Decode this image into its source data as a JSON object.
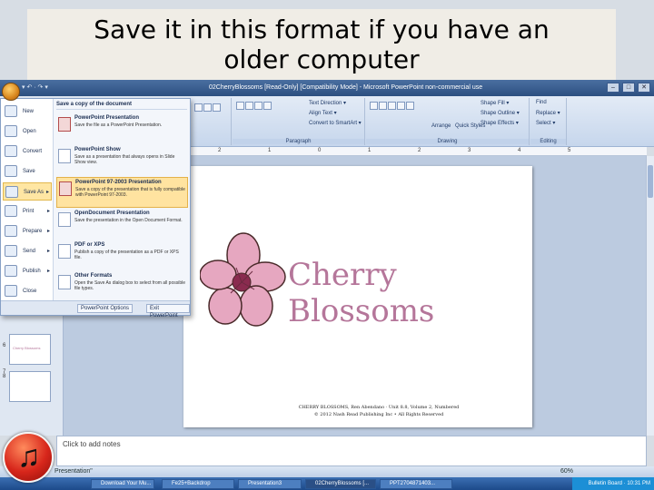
{
  "slide_title": {
    "line1": "Save it in this format if you have an",
    "line2": "older computer"
  },
  "window": {
    "title": "02CherryBlossoms [Read-Only] [Compatibility Mode] - Microsoft PowerPoint non-commercial use",
    "qat": "▾ ↶ · ↷ ▾",
    "controls": [
      "–",
      "□",
      "✕"
    ]
  },
  "ribbon": {
    "groups": [
      {
        "name": "Paragraph",
        "items": [
          "Text Direction ▾",
          "Align Text ▾",
          "Convert to SmartArt ▾"
        ]
      },
      {
        "name": "Drawing",
        "items": [
          "Arrange",
          "Quick Styles",
          "Shape Fill ▾",
          "Shape Outline ▾",
          "Shape Effects ▾"
        ]
      },
      {
        "name": "Editing",
        "items": [
          "Find",
          "Replace ▾",
          "Select ▾"
        ]
      }
    ]
  },
  "ruler": {
    "marks": [
      "2",
      "1",
      "0",
      "1",
      "2",
      "3",
      "4",
      "5"
    ]
  },
  "office_menu": {
    "left_items": [
      {
        "label": "New",
        "has_arrow": false,
        "selected": false,
        "icon": "new-document-icon"
      },
      {
        "label": "Open",
        "has_arrow": false,
        "selected": false,
        "icon": "open-folder-icon"
      },
      {
        "label": "Convert",
        "has_arrow": false,
        "selected": false,
        "icon": "convert-icon"
      },
      {
        "label": "Save",
        "has_arrow": false,
        "selected": false,
        "icon": "save-disk-icon"
      },
      {
        "label": "Save As",
        "has_arrow": true,
        "selected": true,
        "icon": "save-as-icon"
      },
      {
        "label": "Print",
        "has_arrow": true,
        "selected": false,
        "icon": "printer-icon"
      },
      {
        "label": "Prepare",
        "has_arrow": true,
        "selected": false,
        "icon": "prepare-icon"
      },
      {
        "label": "Send",
        "has_arrow": true,
        "selected": false,
        "icon": "send-icon"
      },
      {
        "label": "Publish",
        "has_arrow": true,
        "selected": false,
        "icon": "publish-icon"
      },
      {
        "label": "Close",
        "has_arrow": false,
        "selected": false,
        "icon": "close-folder-icon"
      }
    ],
    "right_header": "Save a copy of the document",
    "options": [
      {
        "title": "PowerPoint Presentation",
        "desc": "Save the file as a PowerPoint Presentation.",
        "selected": false,
        "icon": "pptx-file-icon"
      },
      {
        "title": "PowerPoint Show",
        "desc": "Save as a presentation that always opens in Slide Show view.",
        "selected": false,
        "icon": "ppsx-file-icon"
      },
      {
        "title": "PowerPoint 97-2003 Presentation",
        "desc": "Save a copy of the presentation that is fully compatible with PowerPoint 97-2003.",
        "selected": true,
        "icon": "ppt-legacy-file-icon"
      },
      {
        "title": "OpenDocument Presentation",
        "desc": "Save the presentation in the Open Document Format.",
        "selected": false,
        "icon": "odp-file-icon"
      },
      {
        "title": "PDF or XPS",
        "desc": "Publish a copy of the presentation as a PDF or XPS file.",
        "selected": false,
        "icon": "pdf-file-icon"
      },
      {
        "title": "Other Formats",
        "desc": "Open the Save As dialog box to select from all possible file types.",
        "selected": false,
        "icon": "other-formats-icon"
      }
    ],
    "bottom_buttons": [
      "PowerPoint Options",
      "Exit PowerPoint"
    ]
  },
  "slide": {
    "main_text": "Cherry Blossoms",
    "footer_line1": "CHERRY BLOSSOMS, Ren Abendano · Unit 8.8, Volume 2, Numbered",
    "footer_line2": "© 2012 Nash Read Publishing Inc • All Rights Reserved"
  },
  "thumbnails": [
    {
      "num": "6",
      "text": "Cherry Blossoms"
    },
    {
      "num": "7",
      "text": ""
    },
    {
      "num": "8",
      "text": ""
    }
  ],
  "notes_placeholder": "Click to add notes",
  "status": {
    "label": "Presentation\"",
    "zoom": "60%"
  },
  "taskbar": {
    "items": [
      "Download Your Mu...",
      "Fe25+Backdrop",
      "Presentation3",
      "02CherryBlossoms [...",
      "PPT2704871403..."
    ],
    "tray": "Bulletin Board · 10:31 PM"
  },
  "colors": {
    "accent": "#b5769a",
    "ribbon": "#c6d6ec",
    "menu_sel": "#ffe3a0"
  }
}
